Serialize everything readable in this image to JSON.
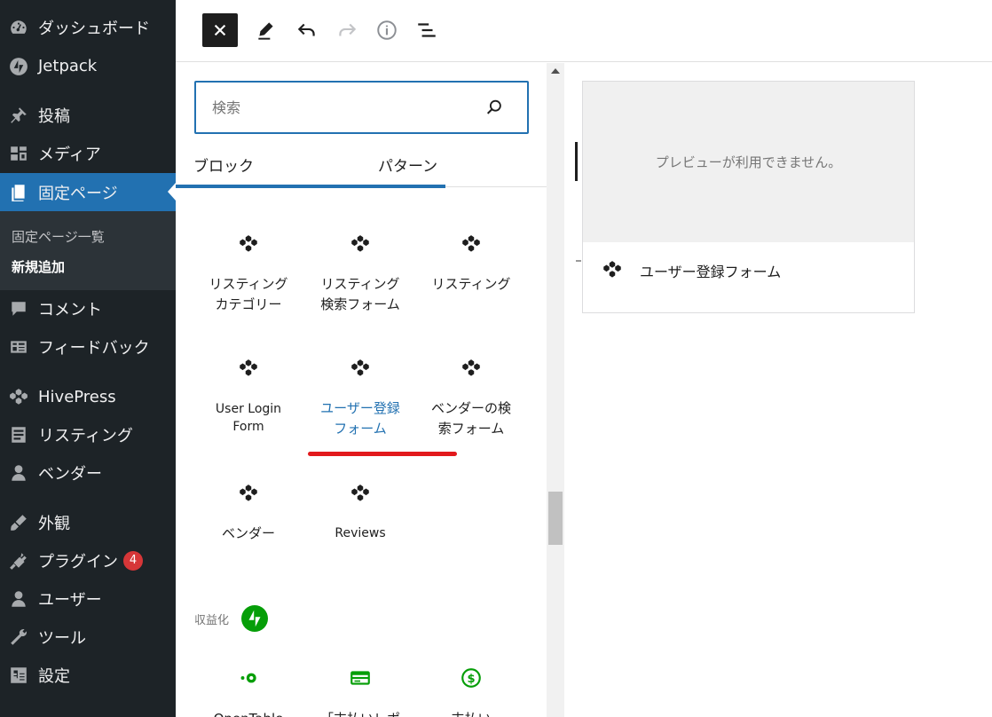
{
  "sidebar": {
    "items": [
      {
        "label": "ダッシュボード",
        "icon": "dashboard-icon"
      },
      {
        "label": "Jetpack",
        "icon": "jetpack-icon"
      },
      {
        "label": "投稿",
        "icon": "pin-icon"
      },
      {
        "label": "メディア",
        "icon": "media-icon"
      },
      {
        "label": "固定ページ",
        "icon": "page-icon",
        "current": true
      },
      {
        "label": "コメント",
        "icon": "comment-icon"
      },
      {
        "label": "フィードバック",
        "icon": "feedback-icon"
      },
      {
        "label": "HivePress",
        "icon": "hivepress-icon"
      },
      {
        "label": "リスティング",
        "icon": "listing-icon"
      },
      {
        "label": "ベンダー",
        "icon": "vendor-icon"
      },
      {
        "label": "外観",
        "icon": "appearance-icon"
      },
      {
        "label": "プラグイン",
        "icon": "plugin-icon",
        "badge": "4"
      },
      {
        "label": "ユーザー",
        "icon": "user-icon"
      },
      {
        "label": "ツール",
        "icon": "tool-icon"
      },
      {
        "label": "設定",
        "icon": "settings-icon"
      }
    ],
    "submenu": [
      {
        "label": "固定ページ一覧"
      },
      {
        "label": "新規追加",
        "active": true
      }
    ]
  },
  "toolbar": {
    "buttons": [
      "close-icon",
      "pencil-icon",
      "undo-icon",
      "redo-icon",
      "info-icon",
      "list-view-icon"
    ]
  },
  "inserter": {
    "search_placeholder": "検索",
    "tabs": [
      "ブロック",
      "パターン"
    ],
    "blocks": [
      {
        "label_1": "リスティング",
        "label_2": "カテゴリー"
      },
      {
        "label_1": "リスティング",
        "label_2": "検索フォーム"
      },
      {
        "label_1": "リスティング",
        "label_2": ""
      },
      {
        "label_1": "User Login",
        "label_2": "Form"
      },
      {
        "label_1": "ユーザー登録",
        "label_2": "フォーム",
        "highlight": true
      },
      {
        "label_1": "ベンダーの検",
        "label_2": "索フォーム"
      },
      {
        "label_1": "ベンダー",
        "label_2": ""
      },
      {
        "label_1": "Reviews",
        "label_2": ""
      }
    ],
    "category_title": "収益化",
    "partial_blocks": [
      "OpenTable",
      "「支払いレポ",
      "支払い"
    ]
  },
  "preview": {
    "unavailable_text": "プレビューが利用できません。",
    "block_name": "ユーザー登録フォーム"
  },
  "colors": {
    "sidebar_bg": "#1d2327",
    "accent": "#2271b1",
    "highlight_underline": "#e2191c",
    "jetpack_green": "#069e08"
  }
}
